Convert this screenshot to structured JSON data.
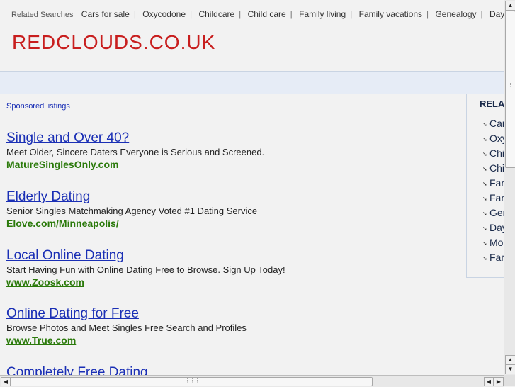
{
  "top_related": {
    "label": "Related Searches",
    "links": [
      "Cars for sale",
      "Oxycodone",
      "Childcare",
      "Child care",
      "Family living",
      "Family vacations",
      "Genealogy",
      "Daycare"
    ]
  },
  "site": {
    "title": "REDCLOUDS.CO.UK"
  },
  "main": {
    "sponsored_label": "Sponsored listings",
    "ads": [
      {
        "title": "Single and Over 40?",
        "desc": "Meet Older, Sincere Daters Everyone is Serious and Screened.",
        "url": "MatureSinglesOnly.com"
      },
      {
        "title": "Elderly Dating",
        "desc": "Senior Singles Matchmaking Agency Voted #1 Dating Service",
        "url": "Elove.com/Minneapolis/"
      },
      {
        "title": "Local Online Dating",
        "desc": "Start Having Fun with Online Dating Free to Browse. Sign Up Today!",
        "url": "www.Zoosk.com"
      },
      {
        "title": "Online Dating for Free",
        "desc": "Browse Photos and Meet Singles Free Search and Profiles",
        "url": "www.True.com"
      },
      {
        "title": "Completely Free Dating",
        "desc": "",
        "url": ""
      }
    ]
  },
  "sidebar": {
    "heading": "RELAT",
    "items": [
      "Car",
      "Oxy",
      "Chi",
      "Chi",
      "Far",
      "Far",
      "Ger",
      "Day",
      "Moc",
      "Far"
    ]
  },
  "colors": {
    "title_red": "#c81e1e",
    "link_blue": "#1a2fb5",
    "url_green": "#2b7a0b"
  }
}
